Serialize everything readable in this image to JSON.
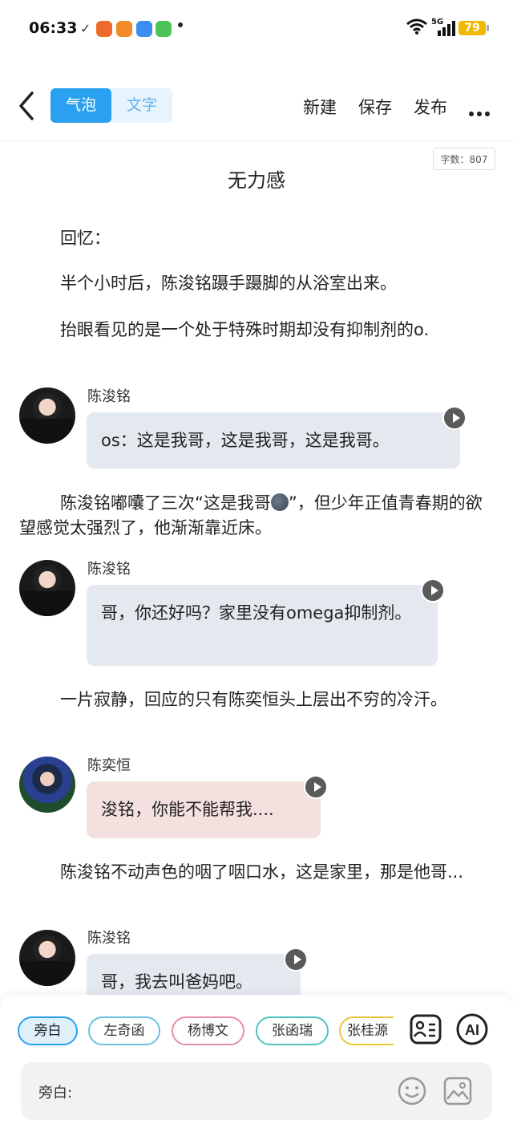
{
  "status_bar": {
    "time": "06:33",
    "check": "✓",
    "network": "5G",
    "battery": "79",
    "app_icon_colors": [
      "#ef6b2c",
      "#f28b2a",
      "#3b8df0",
      "#4cc45a"
    ]
  },
  "toolbar": {
    "tab_bubble": "气泡",
    "tab_text": "文字",
    "new_label": "新建",
    "save_label": "保存",
    "publish_label": "发布"
  },
  "document": {
    "word_count": "字数：807",
    "title": "无力感",
    "p1": "回忆：",
    "p2": "半个小时后，陈浚铭蹑手蹑脚的从浴室出来。",
    "p3": "抬眼看见的是一个处于特殊时期却没有抑制剂的o.",
    "d1_speaker": "陈浚铭",
    "d1_text": "os：这是我哥，这是我哥，这是我哥。",
    "p4_a": "陈浚铭嘟囔了三次“这是我哥",
    "p4_b": "”，但少年正值青春期的欲望感觉太强烈了，他渐渐靠近床。",
    "d2_speaker": "陈浚铭",
    "d2_text": "哥，你还好吗？家里没有omega抑制剂。",
    "p5": "一片寂静，回应的只有陈奕恒头上层出不穷的冷汗。",
    "d3_speaker": "陈奕恒",
    "d3_text": "浚铭，你能不能帮我....",
    "p6": "陈浚铭不动声色的咽了咽口水，这是家里，那是他哥...",
    "d4_speaker": "陈浚铭",
    "d4_text": "哥，我去叫爸妈吧。"
  },
  "characters": [
    {
      "name": "旁白",
      "color": "#2aa0f0"
    },
    {
      "name": "左奇函",
      "color": "#6cc0e0"
    },
    {
      "name": "杨博文",
      "color": "#e58fa2"
    },
    {
      "name": "张函瑞",
      "color": "#4fc3c0"
    },
    {
      "name": "张桂源",
      "color": "#e8c53a"
    }
  ],
  "input": {
    "label": "旁白:"
  },
  "ai_label": "AI",
  "colors": {
    "accent": "#2aa0f0",
    "bubble_blue": "#e4e9f0",
    "bubble_pink": "#f5e0e0"
  }
}
